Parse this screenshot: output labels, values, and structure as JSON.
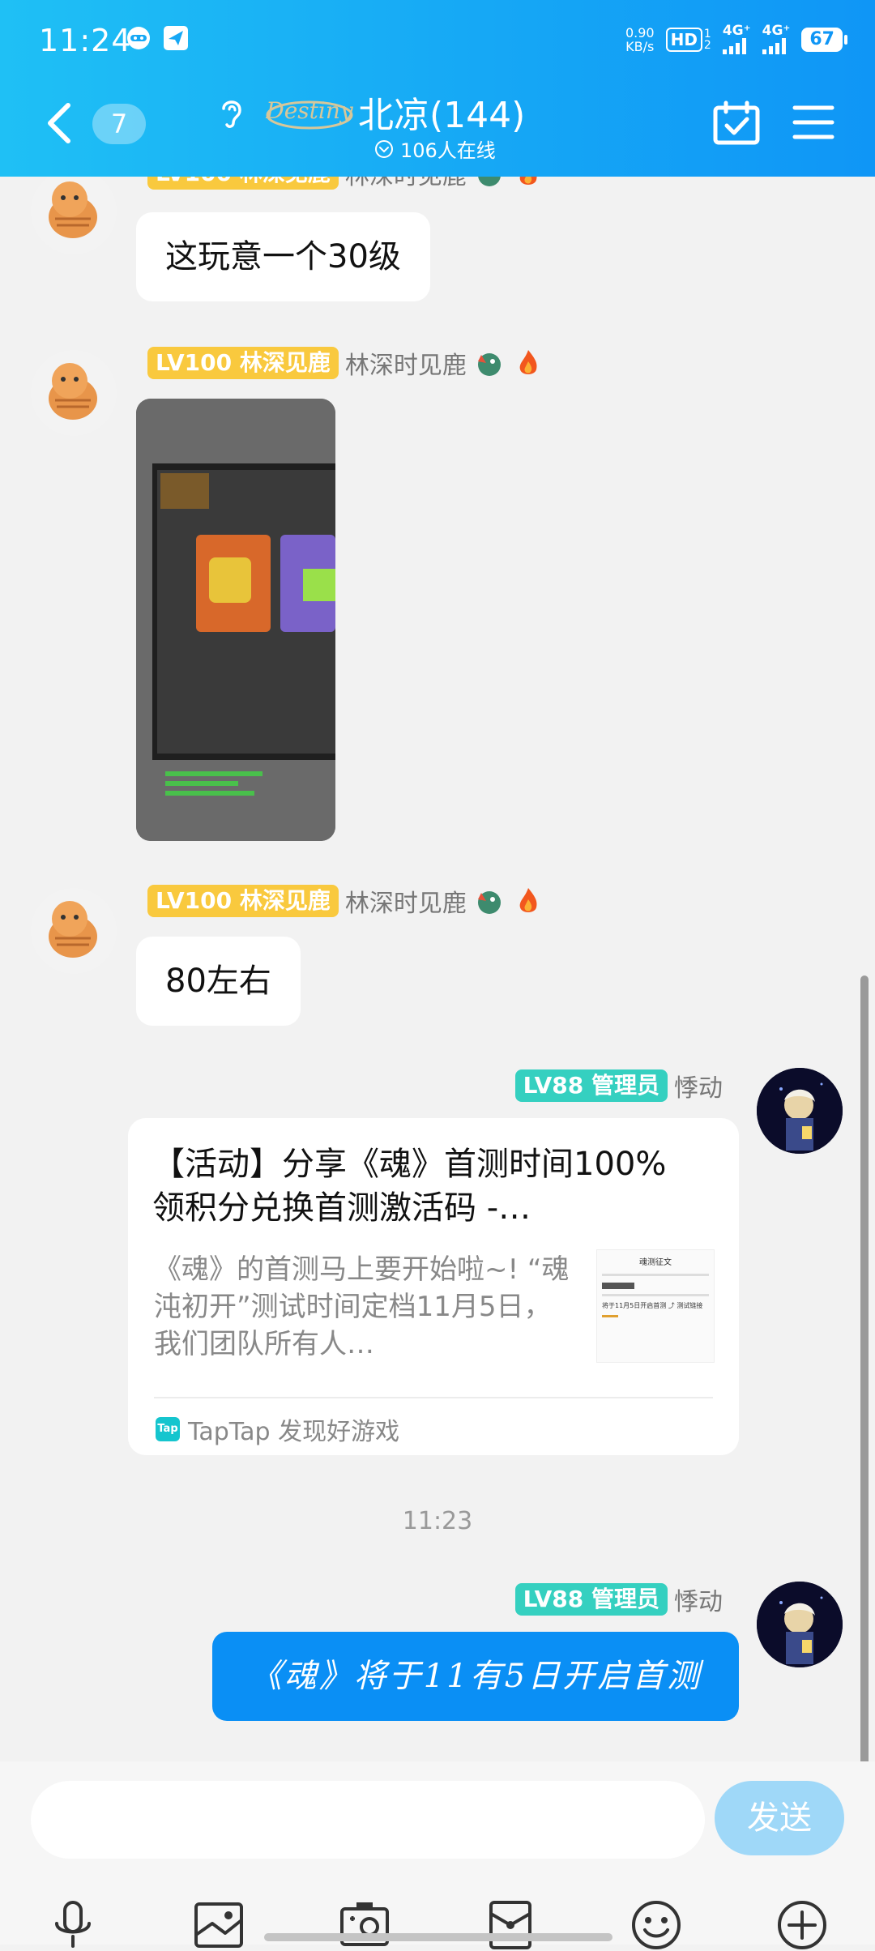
{
  "status_bar": {
    "time": "11:24",
    "net_speed_value": "0.90",
    "net_speed_unit": "KB/s",
    "hd_label": "HD",
    "hd_sub_top": "1",
    "hd_sub_bottom": "2",
    "signal1_label": "4G⁺",
    "signal2_label": "4G⁺",
    "battery": "67"
  },
  "header": {
    "unread_count": "7",
    "logo_text": "Destiny",
    "group_name": "北凉(144)",
    "online_status": "106人在线"
  },
  "messages": {
    "m1": {
      "sender_level": "LV100 林深见鹿",
      "sender_name": "林深时见鹿",
      "text": "这玩意一个30级"
    },
    "m2": {
      "sender_level": "LV100 林深见鹿",
      "sender_name": "林深时见鹿"
    },
    "m3": {
      "sender_level": "LV100 林深见鹿",
      "sender_name": "林深时见鹿",
      "text": "80左右"
    },
    "m4": {
      "sender_level": "LV88 管理员",
      "sender_name": "悸动",
      "card_title": "【活动】分享《魂》首测时间100%领积分兑换首测激活码 -…",
      "card_desc": "《魂》的首测马上要开始啦~! “魂沌初开”测试时间定档11月5日，我们团队所有人…",
      "card_thumb_title": "魂测征文",
      "card_thumb_line": "将于11月5日开启首测 ⤴ 测试链接",
      "card_source": "TapTap 发现好游戏",
      "tap_icon_text": "Tap"
    },
    "time_divider": "11:23",
    "m5": {
      "sender_level": "LV88 管理员",
      "sender_name": "悸动",
      "text": "《魂》将于11有5日开启首测"
    }
  },
  "input": {
    "placeholder": "",
    "send_label": "发送"
  },
  "toolbar": [
    "mic-icon",
    "image-icon",
    "camera-icon",
    "gift-icon",
    "emoji-icon",
    "plus-icon"
  ]
}
